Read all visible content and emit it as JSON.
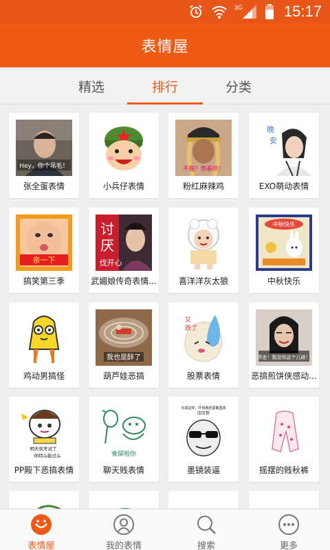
{
  "status_bar": {
    "time": "15:17",
    "network": "3G",
    "icons": [
      "alarm-icon",
      "wifi-icon",
      "signal-icon",
      "battery-icon"
    ]
  },
  "app_title": "表情屋",
  "tabs": [
    {
      "label": "精选",
      "active": false
    },
    {
      "label": "排行",
      "active": true
    },
    {
      "label": "分类",
      "active": false
    }
  ],
  "sticker_packs": [
    {
      "name": "张全蛋表情",
      "thumb_caption": "Hey，你个吊毛！"
    },
    {
      "name": "小兵仔表情",
      "thumb_caption": ""
    },
    {
      "name": "粉红麻辣鸡",
      "thumb_caption": "不服？憋着呗！"
    },
    {
      "name": "EXO萌动表情",
      "thumb_caption": "晚安"
    },
    {
      "name": "搞笑第三季",
      "thumb_caption": "亲一下"
    },
    {
      "name": "武媚娘传奇表情...",
      "thumb_caption": "讨厌 伐开心"
    },
    {
      "name": "喜洋洋灰太狼",
      "thumb_caption": ""
    },
    {
      "name": "中秋快乐",
      "thumb_caption": "中秋快乐"
    },
    {
      "name": "鸡动男搞怪",
      "thumb_caption": ""
    },
    {
      "name": "葫芦娃恶搞",
      "thumb_caption": "我也是醉了"
    },
    {
      "name": "股票表情",
      "thumb_caption": "又跌了"
    },
    {
      "name": "恶搞煎饼侠感动...",
      "thumb_caption": "停走！我没你这个儿砸！"
    },
    {
      "name": "PP殿下恶搞表情",
      "thumb_caption": "明天就考试了 你特么能过么"
    },
    {
      "name": "聊天贱表情",
      "thumb_caption": "食屎啦你"
    },
    {
      "name": "墨镜装逼",
      "thumb_caption": "长成这样，吓得我赶紧戴墨镜压压惊"
    },
    {
      "name": "摇摆的贱秋裤",
      "thumb_caption": ""
    }
  ],
  "bottom_nav": [
    {
      "label": "表情屋",
      "icon": "smiley-face-icon",
      "active": true
    },
    {
      "label": "我的表情",
      "icon": "user-profile-icon",
      "active": false
    },
    {
      "label": "搜索",
      "icon": "search-icon",
      "active": false
    },
    {
      "label": "更多",
      "icon": "more-dots-icon",
      "active": false
    }
  ],
  "colors": {
    "accent": "#ef5a17",
    "status_bar": "#e8561a",
    "background": "#efefef"
  }
}
